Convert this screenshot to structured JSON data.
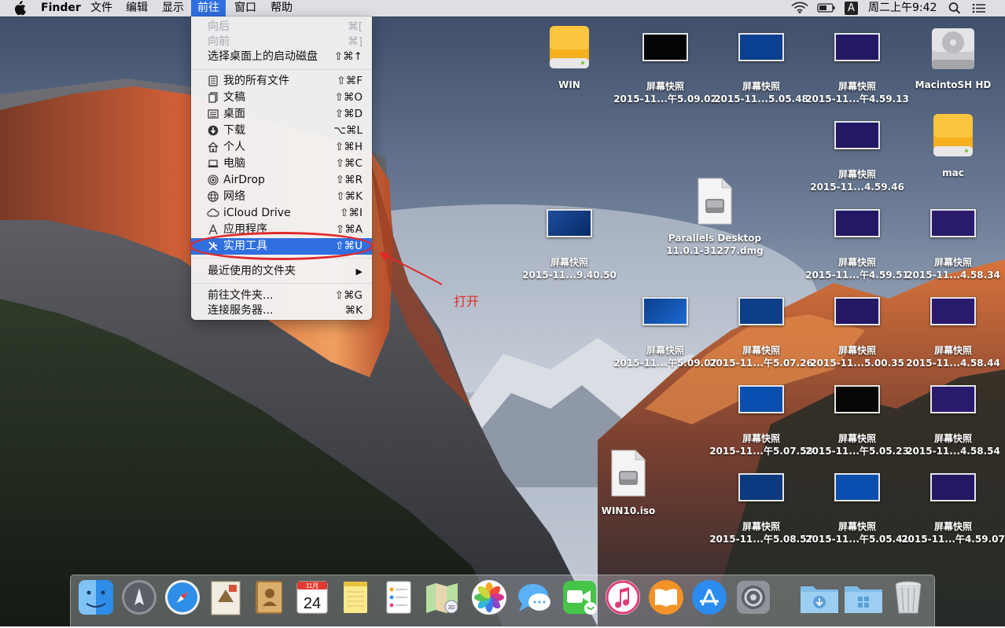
{
  "menubar": {
    "apple_icon": "apple-logo-icon",
    "app_name": "Finder",
    "menus": [
      "文件",
      "编辑",
      "显示",
      "前往",
      "窗口",
      "帮助"
    ],
    "active_menu": "前往",
    "status": {
      "wifi_icon": "wifi-icon",
      "battery_icon": "battery-icon",
      "input_method": "A",
      "clock": "周二上午9:42",
      "search_icon": "spotlight-search-icon",
      "list_icon": "notification-center-icon"
    }
  },
  "go_menu": {
    "items": [
      {
        "label": "向后",
        "shortcut": "⌘[",
        "enabled": false
      },
      {
        "label": "向前",
        "shortcut": "⌘]",
        "enabled": false
      },
      {
        "label": "选择桌面上的启动磁盘",
        "shortcut": "⇧⌘↑",
        "enabled": true
      },
      {
        "label": "我的所有文件",
        "shortcut": "⇧⌘F",
        "icon": "all-files-icon"
      },
      {
        "label": "文稿",
        "shortcut": "⇧⌘O",
        "icon": "documents-icon"
      },
      {
        "label": "桌面",
        "shortcut": "⇧⌘D",
        "icon": "desktop-icon"
      },
      {
        "label": "下载",
        "shortcut": "⌥⌘L",
        "icon": "downloads-icon"
      },
      {
        "label": "个人",
        "shortcut": "⇧⌘H",
        "icon": "home-icon"
      },
      {
        "label": "电脑",
        "shortcut": "⇧⌘C",
        "icon": "computer-icon"
      },
      {
        "label": "AirDrop",
        "shortcut": "⇧⌘R",
        "icon": "airdrop-icon"
      },
      {
        "label": "网络",
        "shortcut": "⇧⌘K",
        "icon": "network-icon"
      },
      {
        "label": "iCloud Drive",
        "shortcut": "⇧⌘I",
        "icon": "icloud-icon"
      },
      {
        "label": "应用程序",
        "shortcut": "⇧⌘A",
        "icon": "applications-icon"
      },
      {
        "label": "实用工具",
        "shortcut": "⇧⌘U",
        "icon": "utilities-icon",
        "selected": true
      },
      {
        "label": "最近使用的文件夹",
        "shortcut": "▶"
      },
      {
        "label": "前往文件夹...",
        "shortcut": "⇧⌘G"
      },
      {
        "label": "连接服务器...",
        "shortcut": "⌘K"
      }
    ]
  },
  "annotation": {
    "text": "打开",
    "color": "#e02a2a"
  },
  "desktop": {
    "icons": [
      {
        "kind": "drive-yellow",
        "label": "WIN"
      },
      {
        "kind": "screenshot-dark",
        "label_line1": "屏幕快照",
        "label_line2": "2015-11...午5.09.02"
      },
      {
        "kind": "screenshot-blue",
        "label_line1": "屏幕快照",
        "label_line2": "2015-11...5.05.48"
      },
      {
        "kind": "screenshot-purple",
        "label_line1": "屏幕快照",
        "label_line2": "2015-11...午4.59.13"
      },
      {
        "kind": "drive-gray",
        "label": "MacintoSH HD"
      },
      {
        "kind": "screenshot-purple",
        "label_line1": "屏幕快照",
        "label_line2": "2015-11...4.59.46"
      },
      {
        "kind": "drive-yellow",
        "label": "mac"
      },
      {
        "kind": "dmg",
        "label_line1": "Parallels Desktop",
        "label_line2": "11.0.1-31277.dmg"
      },
      {
        "kind": "screenshot-win",
        "label_line1": "屏幕快照",
        "label_line2": "2015-11...9.40.50"
      },
      {
        "kind": "screenshot-purple",
        "label_line1": "屏幕快照",
        "label_line2": "2015-11...午4.59.51"
      },
      {
        "kind": "screenshot-purple2",
        "label_line1": "屏幕快照",
        "label_line2": "2015-11...4.58.34"
      },
      {
        "kind": "screenshot-win",
        "label_line1": "屏幕快照",
        "label_line2": "2015-11...午5.09.07"
      },
      {
        "kind": "screenshot-blue",
        "label_line1": "屏幕快照",
        "label_line2": "2015-11...午5.07.26"
      },
      {
        "kind": "screenshot-purple",
        "label_line1": "屏幕快照",
        "label_line2": "2015-11...5.00.35"
      },
      {
        "kind": "screenshot-purple2",
        "label_line1": "屏幕快照",
        "label_line2": "2015-11...4.58.44"
      },
      {
        "kind": "screenshot-blue",
        "label_line1": "屏幕快照",
        "label_line2": "2015-11...午5.07.58"
      },
      {
        "kind": "screenshot-dark",
        "label_line1": "屏幕快照",
        "label_line2": "2015-11...午5.05.23"
      },
      {
        "kind": "screenshot-purple2",
        "label_line1": "屏幕快照",
        "label_line2": "2015-11...4.58.54"
      },
      {
        "kind": "iso",
        "label": "WIN10.iso"
      },
      {
        "kind": "screenshot-blue",
        "label_line1": "屏幕快照",
        "label_line2": "2015-11...午5.08.57"
      },
      {
        "kind": "screenshot-blue",
        "label_line1": "屏幕快照",
        "label_line2": "2015-11...午5.05.41"
      },
      {
        "kind": "screenshot-purple",
        "label_line1": "屏幕快照",
        "label_line2": "2015-11...午4.59.07"
      }
    ]
  },
  "dock": {
    "apps": [
      "finder-icon",
      "launchpad-icon",
      "safari-icon",
      "mail-icon",
      "contacts-icon",
      "calendar-icon",
      "notes-icon",
      "reminders-icon",
      "maps-icon",
      "photos-icon",
      "messages-icon",
      "facetime-icon",
      "itunes-icon",
      "ibooks-icon",
      "app-store-icon",
      "system-preferences-icon",
      "downloads-folder-icon",
      "applications-folder-icon",
      "trash-icon"
    ],
    "calendar_month": "11月",
    "calendar_day": "24"
  }
}
